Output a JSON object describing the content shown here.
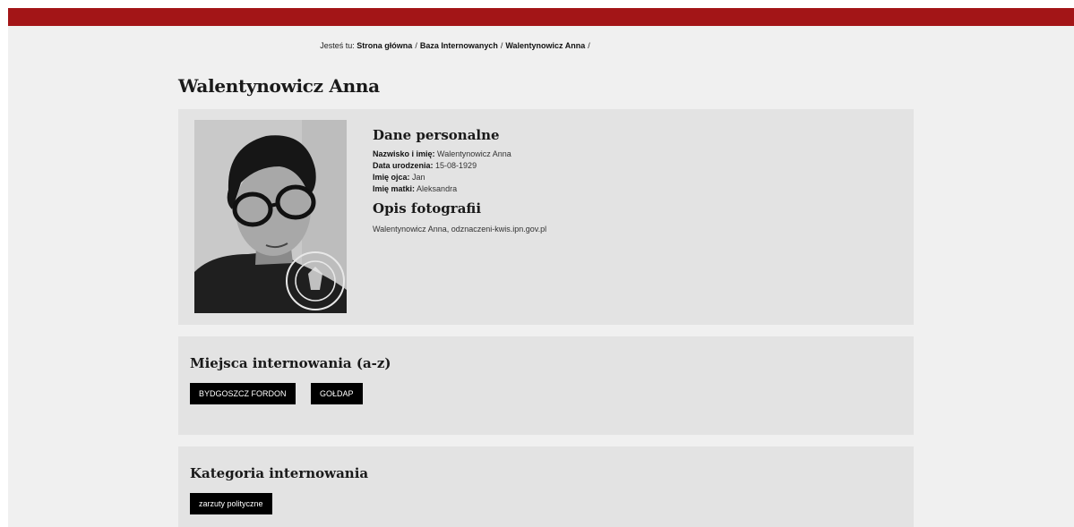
{
  "breadcrumb": {
    "prefix": "Jesteś tu:",
    "items": [
      "Strona główna",
      "Baza Internowanych",
      "Walentynowicz Anna"
    ],
    "separator": "/"
  },
  "page_title": "Walentynowicz Anna",
  "personal": {
    "heading": "Dane personalne",
    "fields": [
      {
        "label": "Nazwisko i imię:",
        "value": "Walentynowicz Anna"
      },
      {
        "label": "Data urodzenia:",
        "value": "15-08-1929"
      },
      {
        "label": "Imię ojca:",
        "value": "Jan"
      },
      {
        "label": "Imię matki:",
        "value": "Aleksandra"
      }
    ]
  },
  "photo_desc": {
    "heading": "Opis fotografii",
    "text": "Walentynowicz Anna, odznaczeni-kwis.ipn.gov.pl"
  },
  "photo_stamp_text": "INSTYTUT PAMIĘCI NARODOWEJ",
  "places": {
    "heading": "Miejsca internowania (a-z)",
    "buttons": [
      "BYDGOSZCZ FORDON",
      "GOŁDAP"
    ]
  },
  "category": {
    "heading": "Kategoria internowania",
    "buttons": [
      "zarzuty polityczne"
    ]
  },
  "colors": {
    "topbar": "#a31517",
    "background": "#f0f0f0",
    "card": "#e3e3e3",
    "button": "#000000"
  }
}
